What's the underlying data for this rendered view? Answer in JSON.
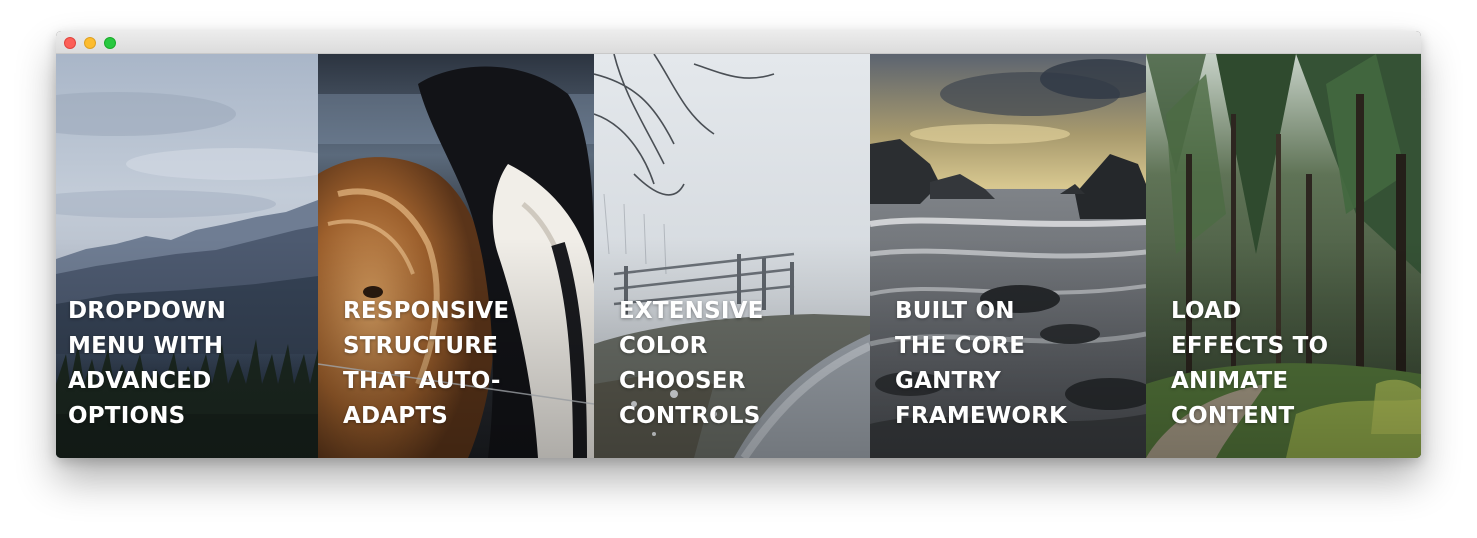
{
  "window": {
    "controls": [
      "close",
      "minimize",
      "maximize"
    ]
  },
  "panels": [
    {
      "id": "dropdown-menu",
      "image": "mountain-lake-photo",
      "caption_lines": [
        "DROPDOWN",
        "MENU WITH",
        "ADVANCED",
        "OPTIONS"
      ]
    },
    {
      "id": "responsive-structure",
      "image": "horses-photo",
      "caption_lines": [
        "RESPONSIVE",
        "STRUCTURE",
        "THAT AUTO-",
        "ADAPTS"
      ]
    },
    {
      "id": "color-chooser",
      "image": "foggy-fence-photo",
      "caption_lines": [
        "EXTENSIVE",
        "COLOR",
        "CHOOSER",
        "CONTROLS"
      ]
    },
    {
      "id": "gantry-framework",
      "image": "rocky-coast-photo",
      "caption_lines": [
        "BUILT ON",
        "THE CORE",
        "GANTRY",
        "FRAMEWORK"
      ]
    },
    {
      "id": "load-effects",
      "image": "forest-path-photo",
      "caption_lines": [
        "LOAD",
        "EFFECTS TO",
        "ANIMATE",
        "CONTENT"
      ]
    }
  ],
  "colors": {
    "close": "#fc5f57",
    "minimize": "#fdbc2e",
    "maximize": "#28c840",
    "caption_text": "#ffffff"
  }
}
